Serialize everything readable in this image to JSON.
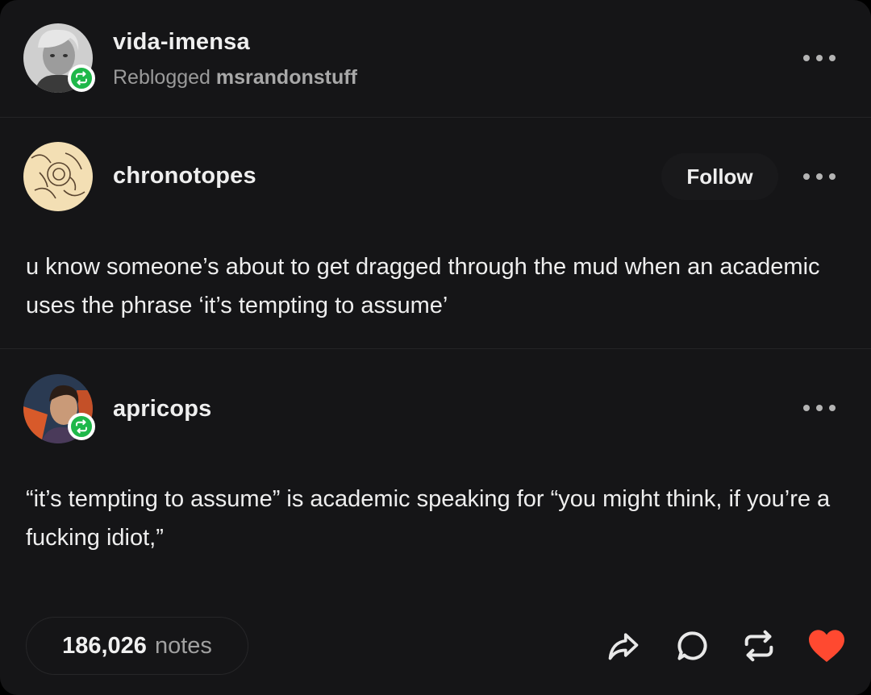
{
  "reblogger": {
    "username": "vida-imensa",
    "reblogged_prefix": "Reblogged",
    "reblogged_from": "msrandonstuff"
  },
  "original_post": {
    "username": "chronotopes",
    "follow_label": "Follow",
    "text": "u know someone’s about to get dragged through the mud when an academic uses the phrase ‘it’s tempting to assume’"
  },
  "reply": {
    "username": "apricops",
    "text": "“it’s tempting to assume” is academic speaking for “you might think, if you’re a fucking idiot,”"
  },
  "footer": {
    "notes_count": "186,026",
    "notes_label": "notes"
  },
  "colors": {
    "background": "#151517",
    "reblog_badge": "#1fb84a",
    "like": "#ff4930"
  },
  "icons": [
    "reblog-icon",
    "more-icon",
    "share-icon",
    "reply-icon",
    "reblog-icon",
    "heart-icon"
  ]
}
